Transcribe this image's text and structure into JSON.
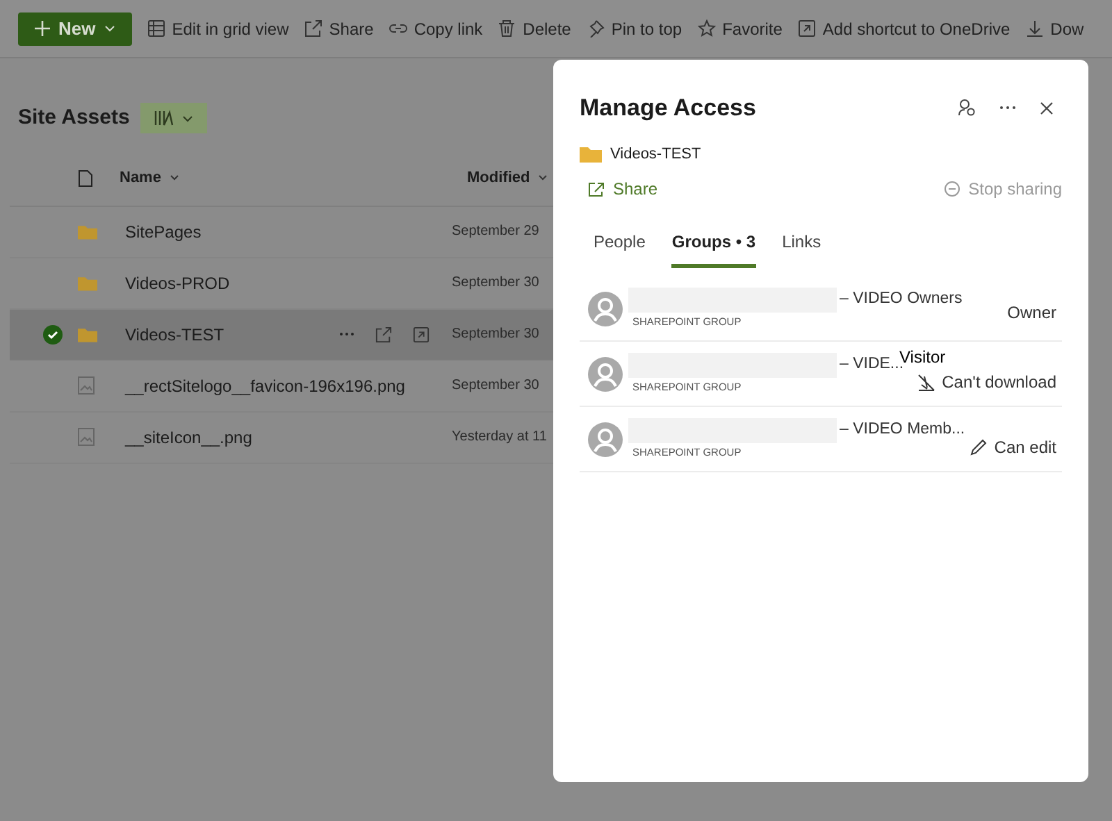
{
  "toolbar": {
    "new_button": "New",
    "items": [
      "Edit in grid view",
      "Share",
      "Copy link",
      "Delete",
      "Pin to top",
      "Favorite",
      "Add shortcut to OneDrive",
      "Dow"
    ]
  },
  "library": {
    "title": "Site Assets"
  },
  "table": {
    "columns": [
      "Name",
      "Modified"
    ],
    "rows": [
      {
        "kind": "folder",
        "name": "SitePages",
        "modified": "September 29",
        "selected": false
      },
      {
        "kind": "folder",
        "name": "Videos-PROD",
        "modified": "September 30",
        "selected": false
      },
      {
        "kind": "folder",
        "name": "Videos-TEST",
        "modified": "September 30",
        "selected": true
      },
      {
        "kind": "image",
        "name": "__rectSitelogo__favicon-196x196.png",
        "modified": "September 30",
        "selected": false
      },
      {
        "kind": "image",
        "name": "__siteIcon__.png",
        "modified": "Yesterday at 11",
        "selected": false
      }
    ]
  },
  "dialog": {
    "title": "Manage Access",
    "item": "Videos-TEST",
    "share": "Share",
    "stop_sharing": {
      "label": "Stop sharing",
      "disabled": true
    },
    "tabs": [
      {
        "label": "People",
        "selected": false
      },
      {
        "label": "Groups • 3",
        "selected": true
      },
      {
        "label": "Links",
        "selected": false
      }
    ],
    "groups": [
      {
        "name": "– VIDEO Owners",
        "type": "SHAREPOINT GROUP",
        "permission": {
          "kind": "plain",
          "label": "Owner"
        }
      },
      {
        "name": "– VIDE...",
        "type": "SHAREPOINT GROUP",
        "permission": {
          "kind": "no-download",
          "label": "Can't download"
        },
        "annotation": "Visitor"
      },
      {
        "name": "– VIDEO Memb...",
        "type": "SHAREPOINT GROUP",
        "permission": {
          "kind": "edit",
          "label": "Can edit"
        }
      }
    ]
  }
}
